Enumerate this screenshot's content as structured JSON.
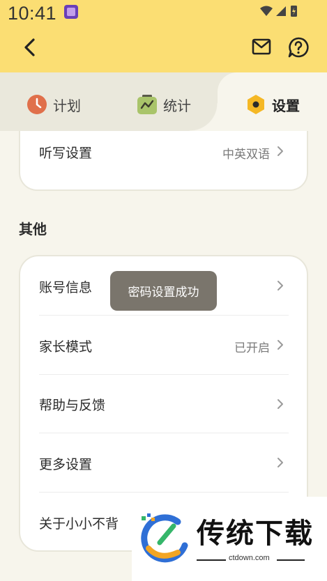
{
  "status_bar": {
    "time": "10:41"
  },
  "icons": {
    "back": "back-arrow-icon",
    "mail": "mail-icon",
    "help": "help-bubble-icon",
    "plan": "clock-icon",
    "stats": "chart-icon",
    "settings": "gear-icon",
    "chevron": "chevron-right-icon"
  },
  "tabs": [
    {
      "label": "计划"
    },
    {
      "label": "统计"
    },
    {
      "label": "设置"
    }
  ],
  "top_card": {
    "dictation": {
      "label": "听写设置",
      "value": "中英双语"
    }
  },
  "other_section": {
    "title": "其他",
    "rows": [
      {
        "label": "账号信息",
        "value": ""
      },
      {
        "label": "家长模式",
        "value": "已开启"
      },
      {
        "label": "帮助与反馈",
        "value": ""
      },
      {
        "label": "更多设置",
        "value": ""
      },
      {
        "label": "关于小小不背",
        "value": ""
      }
    ]
  },
  "toast": {
    "message": "密码设置成功"
  },
  "watermark": {
    "title": "传统下载",
    "site": "ctdown.com"
  },
  "colors": {
    "header": "#fbde73",
    "background": "#f7f5ec",
    "tab_bar": "#eae8dc",
    "clock_icon": "#e0704b",
    "stats_icon": "#a9c46a",
    "settings_icon": "#f5b825",
    "toast": "#7a756c"
  }
}
